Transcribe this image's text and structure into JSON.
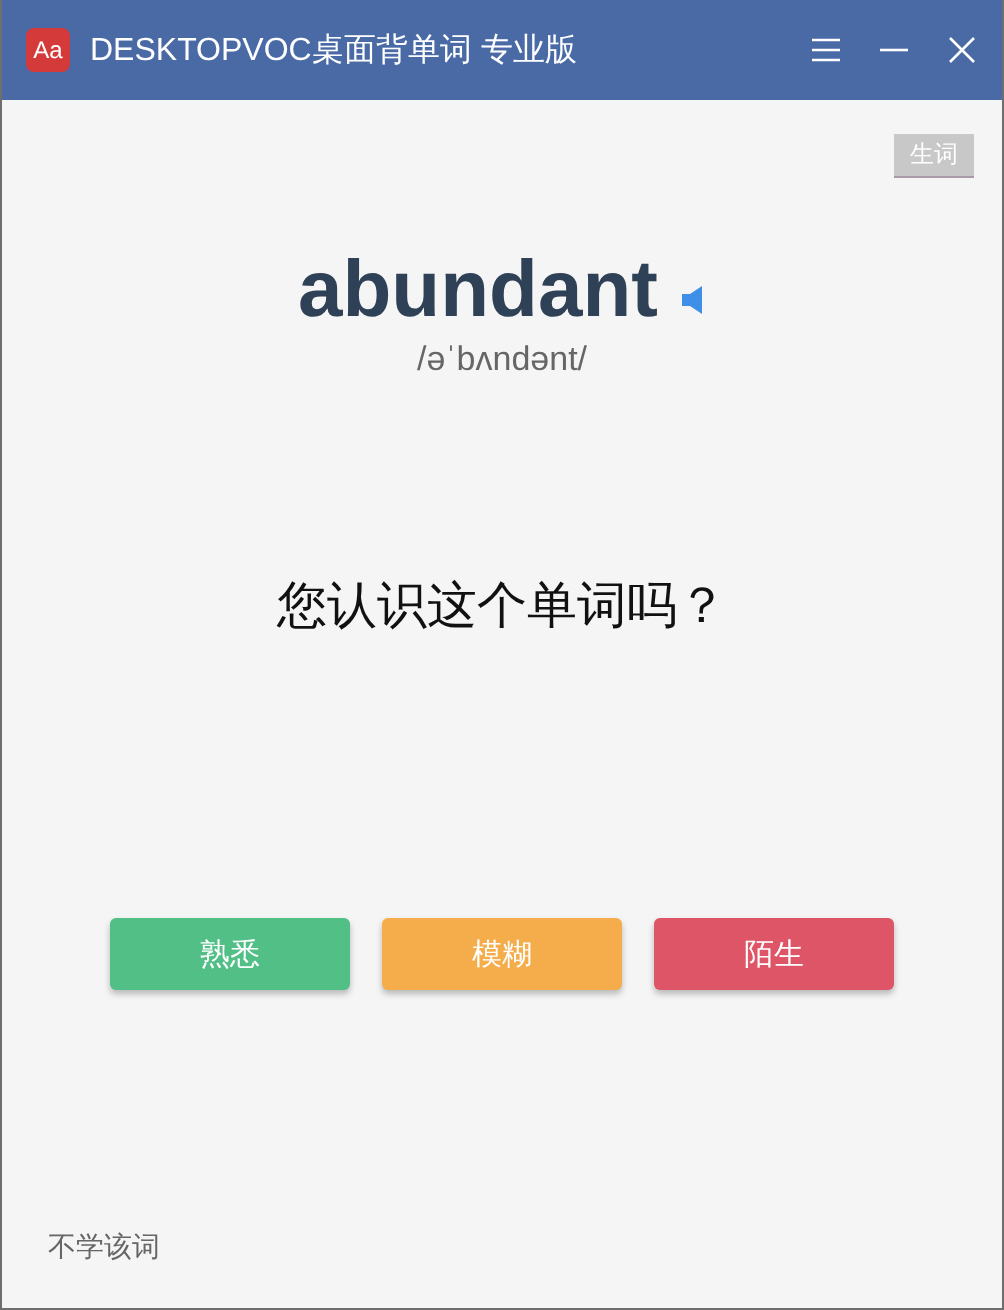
{
  "window": {
    "logo": "Aa",
    "title": "DESKTOPVOC桌面背单词 专业版"
  },
  "tag_button": "生词",
  "word": {
    "text": "abundant",
    "phonetic": "/əˈbʌndənt/"
  },
  "question": "您认识这个单词吗？",
  "answers": [
    {
      "label": "熟悉",
      "color": "#52bf87"
    },
    {
      "label": "模糊",
      "color": "#f4ad4a"
    },
    {
      "label": "陌生",
      "color": "#dd5566"
    }
  ],
  "footer_link": "不学该词"
}
